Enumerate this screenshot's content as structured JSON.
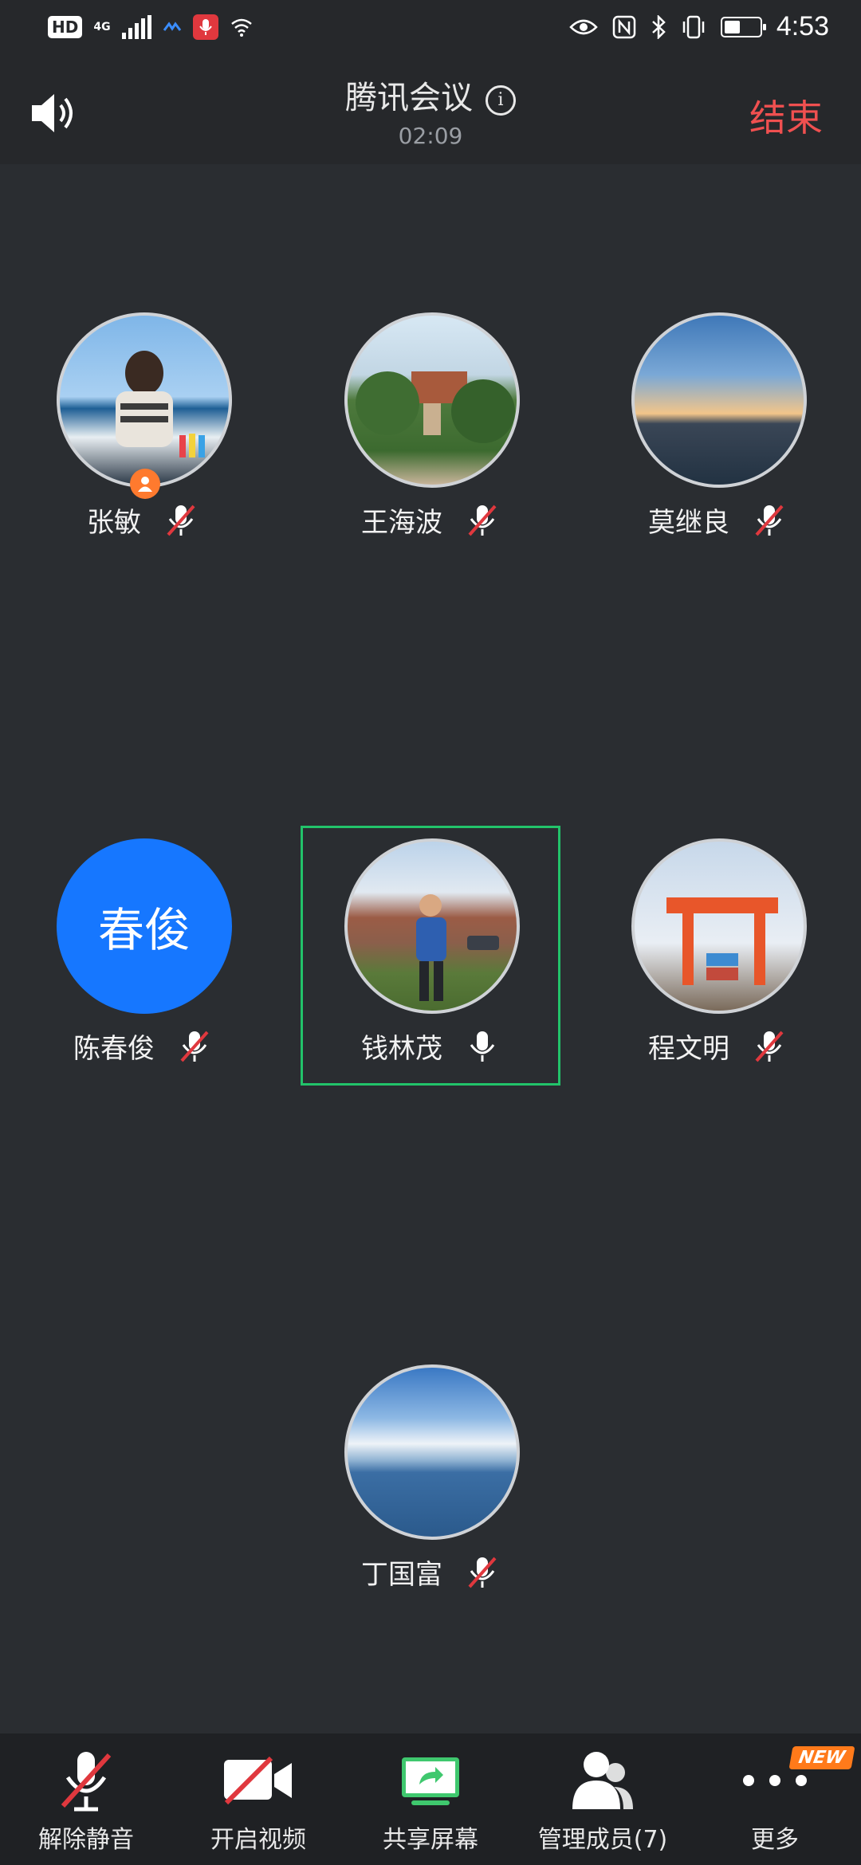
{
  "status_bar": {
    "hd": "HD",
    "network": "4G",
    "time": "4:53",
    "battery_level": 0.45
  },
  "header": {
    "title": "腾讯会议",
    "info_icon": "i",
    "duration": "02:09",
    "end_label": "结束"
  },
  "members": [
    {
      "name": "张敏",
      "avatar_type": "photo-person",
      "host": true,
      "muted": true
    },
    {
      "name": "王海波",
      "avatar_type": "photo-building",
      "muted": true
    },
    {
      "name": "莫继良",
      "avatar_type": "photo-sunset",
      "muted": true
    },
    {
      "name": "陈春俊",
      "avatar_type": "initials",
      "initials": "春俊",
      "avatar_color": "#1677ff",
      "muted": true
    },
    {
      "name": "钱林茂",
      "avatar_type": "photo-person-outdoor",
      "muted": false,
      "speaking": true
    },
    {
      "name": "程文明",
      "avatar_type": "photo-crane",
      "muted": true
    },
    {
      "name": "丁国富",
      "avatar_type": "photo-sea",
      "muted": true
    }
  ],
  "toolbar": {
    "unmute": "解除静音",
    "video": "开启视频",
    "share": "共享屏幕",
    "members": "管理成员(7)",
    "more": "更多",
    "new_badge": "NEW"
  },
  "colors": {
    "accent_green": "#22c36a",
    "end_red": "#f05050",
    "mute_red": "#e0383e",
    "host_orange": "#ff7a2e"
  }
}
